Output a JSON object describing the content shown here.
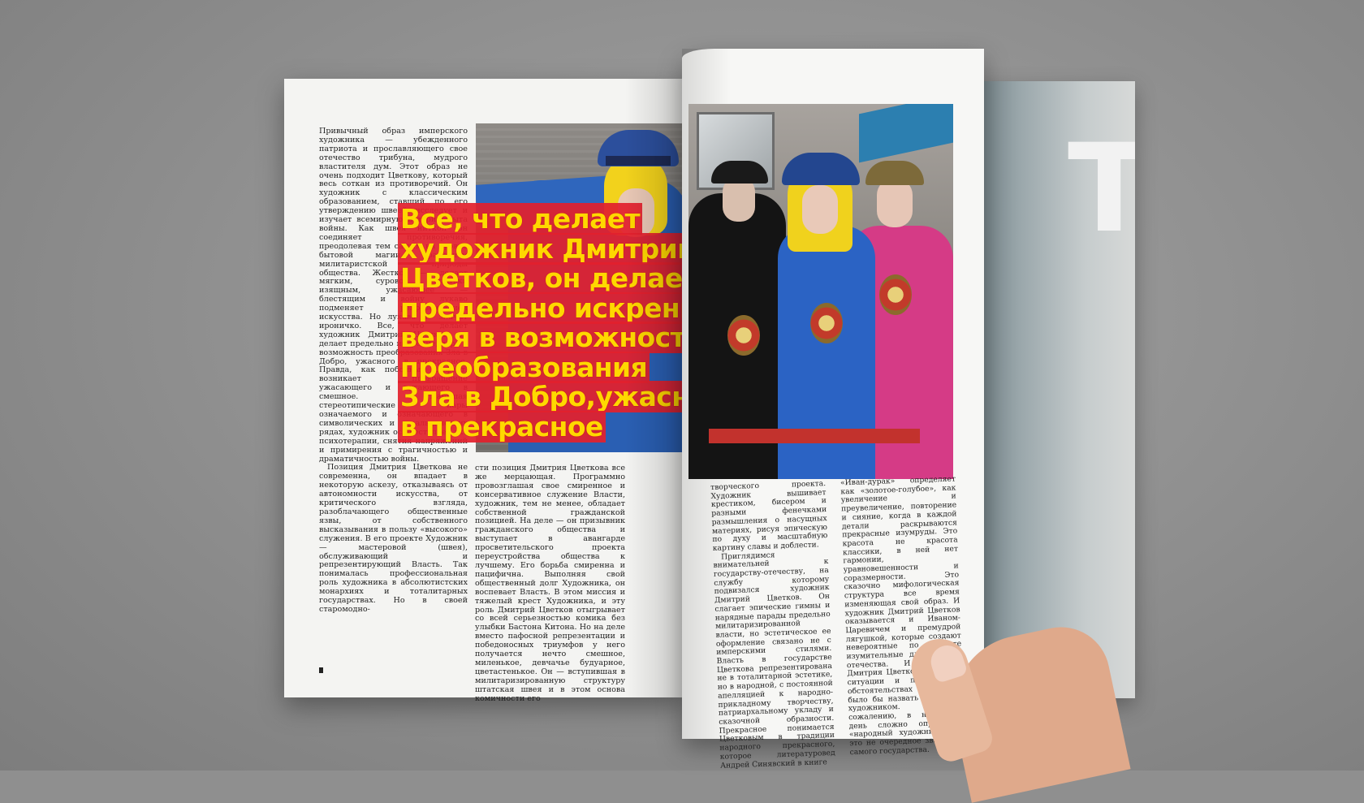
{
  "colors": {
    "background": "#8f8f8f",
    "headline_fill": "#ffd800",
    "headline_band": "#e2202d",
    "page": "#f4f4f2"
  },
  "back_page": {
    "letter": "Т"
  },
  "left_page": {
    "col_a": [
      "Привычный образ имперского художника — убежденного патриота и прославляющего свое отечество трибуна, мудрого властителя дум. Этот образ не очень подходит Цветкову, который весь соткан из противоречий. Он художник с классическим образованием, ставший по его утверждению швеей, исследует и изучает всемирную историю быта войны. Как швея ниткой он соединяет противоречия, преодолевая тем самым на уровне бытовой магии драматизм милитаристской природы общества. Жесткое — делает мягким, суровое эстетски изящным, ужасающее — блестящим и войну лукаво подменяет репрезентацией искусства. Но лукаво не значит ироничко. Все, что делает художник Дмитрий Цветков, он делает предельно искренне, веря в возможность преобразования Зла в Добро, ужасного в прекрасное. Правда, как побочный эффект, возникает превращение ужасающего и пугающего в смешное. Нарушая стереотипические пары означаемого и означающего в символических и геральдических рядах, художник осуществляет акт психотерапии, снятия напряжений и примирения с трагичностью и драматичностью войны.",
      "Позиция Дмитрия Цветкова не современна, он впадает в некоторую аскезу, отказываясь от автономности искусства, от критического взгляда, разоблачающего общественные язвы, от собственного высказывания в пользу «высокого» служения. В его проекте Художник — мастеровой (швея), обслуживающий и репрезентирующий Власть. Так понималась профессиональная роль художника в абсолютистских монархиях и тоталитарных государствах. Но в своей старомодно-"
    ],
    "col_b": "сти позиция Дмитрия Цветкова все же мерцающая. Программно провозглашая свое смиренное и консервативное служение Власти, художник, тем не менее, обладает собственной гражданской позицией. На деле — он призывник гражданского общества и выступает в авангарде просветительского проекта переустройства общества к лучшему. Его борьба смиренна и пацифична. Выполняя свой общественный долг Художника, он воспевает Власть. В этом миссия и тяжелый крест Художника, и эту роль Дмитрий Цветков отыгрывает со всей серьезностью комика без улыбки Бастона Китона. Но на деле вместо пафосной репрезентации и победоносных триумфов у него получается нечто смешное, миленькое, девчачье будуарное, цветастенькое. Он — вступившая в милитаризированную структуру штатская швея и в этом основа комичности его",
    "headline_lines": [
      "Все, что делает",
      "художник Дмитрий",
      "Цветков, он делает",
      "предельно искренне,",
      "веря в возможность",
      "преобразования",
      "Зла в Добро,ужасного",
      "в прекрасное"
    ]
  },
  "right_page": {
    "col_1": [
      "творческого проекта. Художник вышивает крестиком, бисером и разными фенечками размышления о насущных материях, рисуя эпическую по духу и масштабную картину славы и доблести.",
      "Приглядимся внимательней к государству-отечеству, на службу которому подвизался художник Дмитрий Цветков. Он слагает эпические гимны и нарядные парады предельно милитаризированной власти, но эстетическое ее оформление связано не с имперскими стилями. Власть в государстве Цветкова репрезентирована не в тоталитарной эстетике, но в народной, с постоянной апелляцией к народно-прикладному творчеству, патриархальному укладу и сказочной образности. Прекрасное понимается Цветковым в традиции народного прекрасного, которое литературовед Андрей Синявский в книге"
    ],
    "col_2": "«Иван-дурак» определяет как «золотое-голубое», как увеличение и преувеличение, повторение и сияние, когда в каждой детали раскрываются прекрасные изумруды. Это красота не красота классики, в ней нет гармонии, уравновешенности и соразмерности. Это сказочно мифологическая структура все время изменяющая свой образ. И художник Дмитрий Цветков оказывается и Иваном-Царевичем и премудрой лягушкой, которые создают невероятные по красоте изумительные для царя — отечества. И вероятно Дмитрия Цветкова в другой ситуации и при других обстоятельствах можно было бы назвать народным художником. Но, к сожалению, в нынешний день сложно определить «народный художник», его это не очередное звание от самого государства."
  }
}
